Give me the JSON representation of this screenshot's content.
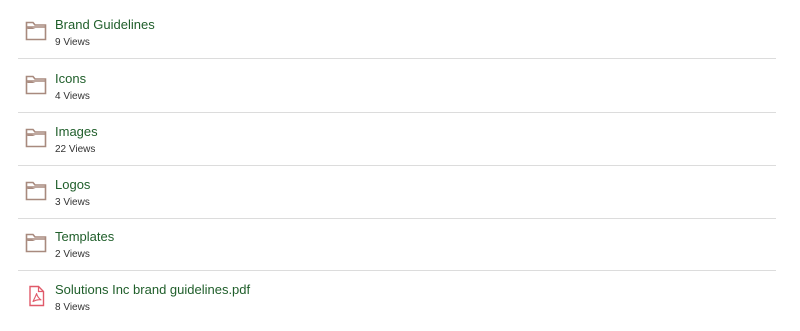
{
  "items": [
    {
      "name": "Brand Guidelines",
      "views": "9 Views",
      "icon": "folder-icon",
      "type": "folder"
    },
    {
      "name": "Icons",
      "views": "4 Views",
      "icon": "folder-icon",
      "type": "folder"
    },
    {
      "name": "Images",
      "views": "22 Views",
      "icon": "folder-icon",
      "type": "folder"
    },
    {
      "name": "Logos",
      "views": "3 Views",
      "icon": "folder-icon",
      "type": "folder"
    },
    {
      "name": "Templates",
      "views": "2 Views",
      "icon": "folder-icon",
      "type": "folder"
    },
    {
      "name": "Solutions Inc brand guidelines.pdf",
      "views": "8 Views",
      "icon": "pdf-icon",
      "type": "pdf"
    }
  ],
  "colors": {
    "link_text": "#1f5e2a",
    "meta_text": "#333333",
    "folder_icon": "#a88a7e",
    "pdf_icon": "#e05a6a",
    "divider": "#dcdcdc"
  }
}
